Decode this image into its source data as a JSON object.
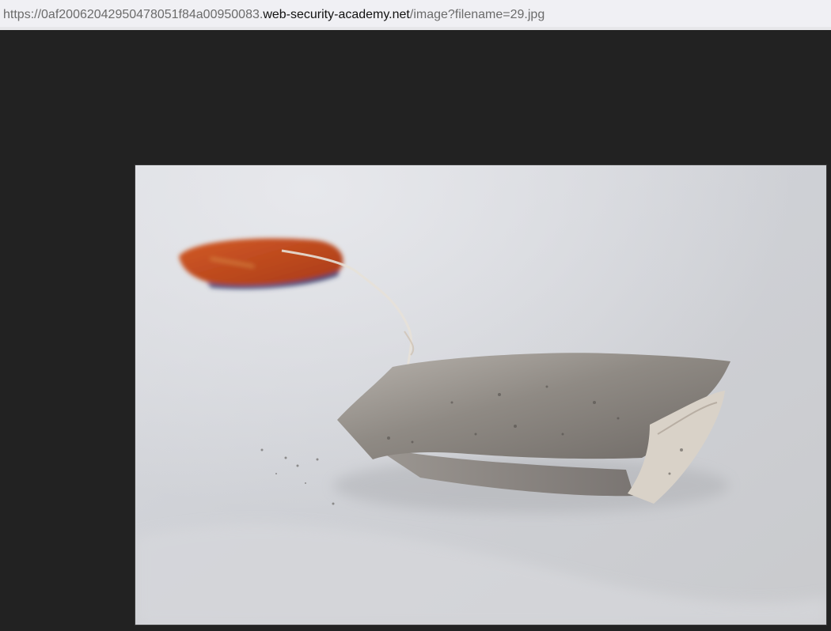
{
  "address_bar": {
    "url_prefix": "https://0af20062042950478051f84a00950083.",
    "url_host": "web-security-academy.net",
    "url_path": "/image?filename=29.jpg"
  },
  "viewer": {
    "background_color": "#222222",
    "image_filename": "29.jpg",
    "image_subject_icon": "tea-bag-photo"
  },
  "colors": {
    "address_bar_bg": "#f0f0f4",
    "url_dim": "#6b6b6b",
    "url_host": "#111111"
  }
}
